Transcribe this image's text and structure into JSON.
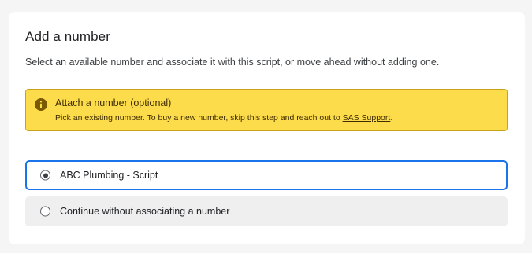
{
  "header": {
    "title": "Add a number",
    "subtitle": "Select an available number and associate it with this script, or move ahead without adding one."
  },
  "alert": {
    "icon": "info-icon",
    "title": "Attach a number (optional)",
    "body_before_link": "Pick an existing number. To buy a new number, skip this step and reach out to ",
    "link_text": "SAS Support",
    "body_after_link": ".",
    "background_color": "#fddc4b",
    "border_color": "#c9a21b"
  },
  "options": [
    {
      "label": "ABC Plumbing - Script",
      "selected": true
    },
    {
      "label": "Continue without associating a number",
      "selected": false
    }
  ],
  "colors": {
    "accent": "#1a73e8"
  }
}
